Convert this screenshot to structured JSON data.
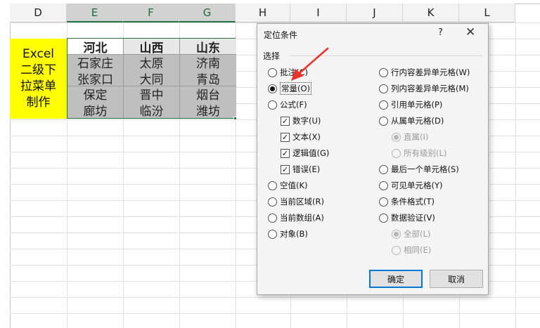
{
  "spreadsheet": {
    "columns": [
      "D",
      "E",
      "F",
      "G",
      "H",
      "I",
      "J",
      "K",
      "L"
    ],
    "selected_columns": [
      "E",
      "F",
      "G"
    ],
    "merged_cell": {
      "lines": [
        "Excel",
        "二级下",
        "拉菜单",
        "制作"
      ],
      "fill": "#ffff00"
    },
    "table": {
      "headers": [
        "河北",
        "山西",
        "山东"
      ],
      "rows": [
        [
          "石家庄",
          "太原",
          "济南"
        ],
        [
          "张家口",
          "大同",
          "青岛"
        ],
        [
          "保定",
          "晋中",
          "烟台"
        ],
        [
          "廊坊",
          "临汾",
          "潍坊"
        ]
      ]
    }
  },
  "dialog": {
    "title": "定位条件",
    "help": "?",
    "close": "✕",
    "section_label": "选择",
    "left_options": [
      {
        "label": "批注(C)",
        "type": "radio",
        "checked": false,
        "disabled": false
      },
      {
        "label": "常量(O)",
        "type": "radio",
        "checked": true,
        "disabled": false
      },
      {
        "label": "公式(F)",
        "type": "radio",
        "checked": false,
        "disabled": false
      },
      {
        "label": "数字(U)",
        "type": "checkbox",
        "checked": true,
        "disabled": false
      },
      {
        "label": "文本(X)",
        "type": "checkbox",
        "checked": true,
        "disabled": false
      },
      {
        "label": "逻辑值(G)",
        "type": "checkbox",
        "checked": true,
        "disabled": false
      },
      {
        "label": "错误(E)",
        "type": "checkbox",
        "checked": true,
        "disabled": false
      },
      {
        "label": "空值(K)",
        "type": "radio",
        "checked": false,
        "disabled": false
      },
      {
        "label": "当前区域(R)",
        "type": "radio",
        "checked": false,
        "disabled": false
      },
      {
        "label": "当前数组(A)",
        "type": "radio",
        "checked": false,
        "disabled": false
      },
      {
        "label": "对象(B)",
        "type": "radio",
        "checked": false,
        "disabled": false
      }
    ],
    "right_options": [
      {
        "label": "行内容差异单元格(W)",
        "type": "radio",
        "checked": false,
        "disabled": false
      },
      {
        "label": "列内容差异单元格(M)",
        "type": "radio",
        "checked": false,
        "disabled": false
      },
      {
        "label": "引用单元格(P)",
        "type": "radio",
        "checked": false,
        "disabled": false
      },
      {
        "label": "从属单元格(D)",
        "type": "radio",
        "checked": false,
        "disabled": false
      },
      {
        "label": "直属(I)",
        "type": "radio",
        "checked": true,
        "disabled": true
      },
      {
        "label": "所有级别(L)",
        "type": "radio",
        "checked": false,
        "disabled": true
      },
      {
        "label": "最后一个单元格(S)",
        "type": "radio",
        "checked": false,
        "disabled": false
      },
      {
        "label": "可见单元格(Y)",
        "type": "radio",
        "checked": false,
        "disabled": false
      },
      {
        "label": "条件格式(T)",
        "type": "radio",
        "checked": false,
        "disabled": false
      },
      {
        "label": "数据验证(V)",
        "type": "radio",
        "checked": false,
        "disabled": false
      },
      {
        "label": "全部(L)",
        "type": "radio",
        "checked": true,
        "disabled": true
      },
      {
        "label": "相同(E)",
        "type": "radio",
        "checked": false,
        "disabled": true
      }
    ],
    "ok_label": "确定",
    "cancel_label": "取消"
  },
  "annotation": {
    "arrow_color": "#e8322b"
  },
  "colors": {
    "accent": "#217346",
    "button_focus": "#0078d7",
    "highlight": "#ffff00"
  }
}
